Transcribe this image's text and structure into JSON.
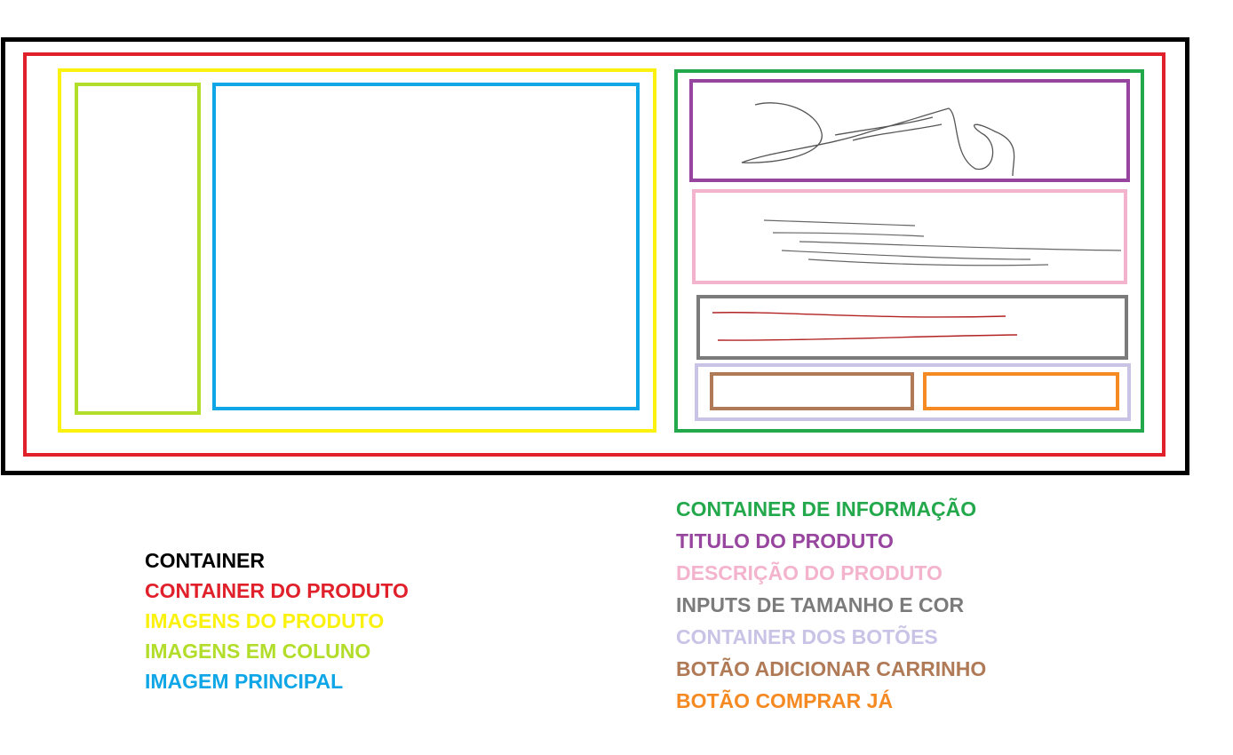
{
  "legend_left": [
    {
      "label": "CONTAINER",
      "color": "#000000"
    },
    {
      "label": "CONTAINER DO PRODUTO",
      "color": "#e0202a"
    },
    {
      "label": "IMAGENS DO PRODUTO",
      "color": "#fbf10e"
    },
    {
      "label": "IMAGENS EM COLUNO",
      "color": "#b2dd2a"
    },
    {
      "label": "IMAGEM PRINCIPAL",
      "color": "#0ea6e6"
    }
  ],
  "legend_right": [
    {
      "label": "CONTAINER DE INFORMAÇÃO",
      "color": "#23a84c"
    },
    {
      "label": "TITULO DO PRODUTO",
      "color": "#97459e"
    },
    {
      "label": "DESCRIÇÃO DO PRODUTO",
      "color": "#f4b3cc"
    },
    {
      "label": "INPUTS DE TAMANHO E COR",
      "color": "#7b7b7b"
    },
    {
      "label": "CONTAINER DOS BOTÕES",
      "color": "#c9c3e6"
    },
    {
      "label": "BOTÃO ADICIONAR CARRINHO",
      "color": "#b07a56"
    },
    {
      "label": "BOTÃO COMPRAR JÁ",
      "color": "#f58a23"
    }
  ]
}
